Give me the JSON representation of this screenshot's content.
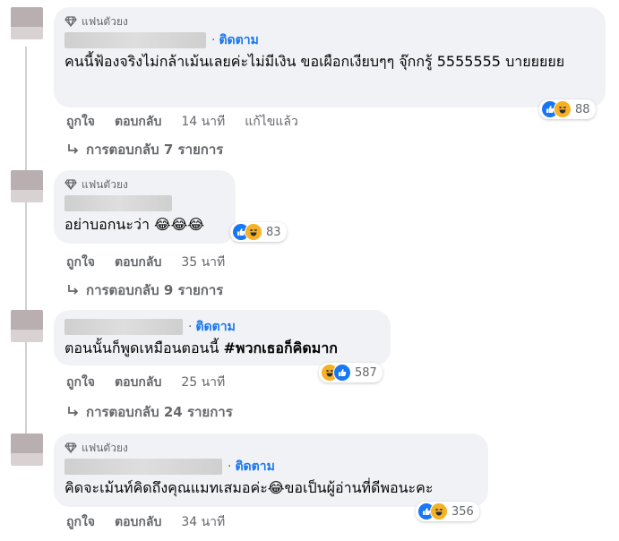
{
  "comments": [
    {
      "badge": "แฟนตัวยง",
      "follow": "ติดตาม",
      "text": "คนนี้ฟ้องจริงไม่กล้าเม้นเลยค่ะไม่มีเงิน ขอเผือกเงียบๆๆ จุ๊กกรู้ 5555555 บายยยยย",
      "actions": [
        "ถูกใจ",
        "ตอบกลับ"
      ],
      "time": "14 นาที",
      "edited": "แก้ไขแล้ว",
      "reaction_count": "88",
      "reactions": [
        "like-icon",
        "haha-icon"
      ],
      "replies": "การตอบกลับ 7 รายการ"
    },
    {
      "badge": "แฟนตัวยง",
      "text": "อย่าบอกนะว่า 😂😂😂",
      "actions": [
        "ถูกใจ",
        "ตอบกลับ"
      ],
      "time": "35 นาที",
      "reaction_count": "83",
      "reactions": [
        "like-icon",
        "haha-icon"
      ],
      "replies": "การตอบกลับ 9 รายการ"
    },
    {
      "follow": "ติดตาม",
      "text_plain": "ตอนนั้นก็พูดเหมือนตอนนี้ ",
      "hashtag": "#พวกเธอก็คิดมาก",
      "actions": [
        "ถูกใจ",
        "ตอบกลับ"
      ],
      "time": "25 นาที",
      "reaction_count": "587",
      "reactions": [
        "haha-icon",
        "like-icon"
      ],
      "replies": "การตอบกลับ 24 รายการ"
    },
    {
      "badge": "แฟนตัวยง",
      "follow": "ติดตาม",
      "text": "คิดจะเม้นท์คิดถึงคุณแมทเสมอค่ะ😂ขอเป็นผู้อ่านที่ดีพอนะคะ",
      "actions": [
        "ถูกใจ",
        "ตอบกลับ"
      ],
      "time": "34 นาที",
      "reaction_count": "356",
      "reactions": [
        "like-icon",
        "haha-icon"
      ]
    }
  ],
  "colors": {
    "bubble": "#f0f2f5",
    "link": "#1877f2",
    "muted": "#65676b",
    "like": "#1877f2",
    "haha": "#f7b125"
  }
}
